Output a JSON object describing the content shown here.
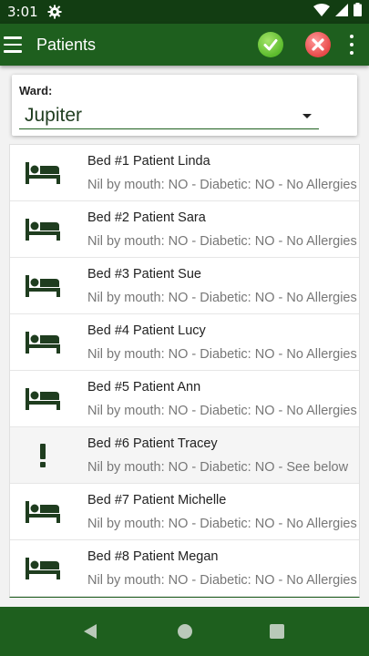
{
  "status_bar": {
    "time": "3:01",
    "icons": [
      "settings-gear-icon",
      "wifi-icon",
      "signal-icon",
      "battery-icon"
    ]
  },
  "app_bar": {
    "title": "Patients",
    "actions": [
      "confirm-icon",
      "cancel-icon",
      "overflow-menu-icon"
    ]
  },
  "ward": {
    "label": "Ward:",
    "selected": "Jupiter"
  },
  "patients": [
    {
      "title": "Bed #1 Patient Linda",
      "details": "Nil by mouth: NO - Diabetic: NO - No Allergies",
      "icon": "bed-icon"
    },
    {
      "title": "Bed #2 Patient Sara",
      "details": "Nil by mouth: NO - Diabetic: NO - No Allergies",
      "icon": "bed-icon"
    },
    {
      "title": "Bed #3 Patient Sue",
      "details": "Nil by mouth: NO - Diabetic: NO - No Allergies",
      "icon": "bed-icon"
    },
    {
      "title": "Bed #4 Patient Lucy",
      "details": "Nil by mouth: NO - Diabetic: NO - No Allergies",
      "icon": "bed-icon"
    },
    {
      "title": "Bed #5 Patient Ann",
      "details": "Nil by mouth: NO - Diabetic: NO - No Allergies",
      "icon": "bed-icon"
    },
    {
      "title": "Bed #6 Patient Tracey",
      "details": "Nil by mouth: NO - Diabetic: NO - See below",
      "icon": "alert-icon"
    },
    {
      "title": "Bed #7 Patient Michelle",
      "details": "Nil by mouth: NO - Diabetic: NO - No Allergies",
      "icon": "bed-icon"
    },
    {
      "title": "Bed #8 Patient Megan",
      "details": "Nil by mouth: NO - Diabetic: NO - No Allergies",
      "icon": "bed-icon"
    }
  ],
  "nav_bar": {
    "buttons": [
      "back-icon",
      "home-icon",
      "recents-icon"
    ]
  },
  "colors": {
    "status_bar": "#123d12",
    "app_bar": "#1e5f1e",
    "accent": "#1e5f1e",
    "confirm": "#5bbb2c",
    "cancel": "#e84848"
  }
}
